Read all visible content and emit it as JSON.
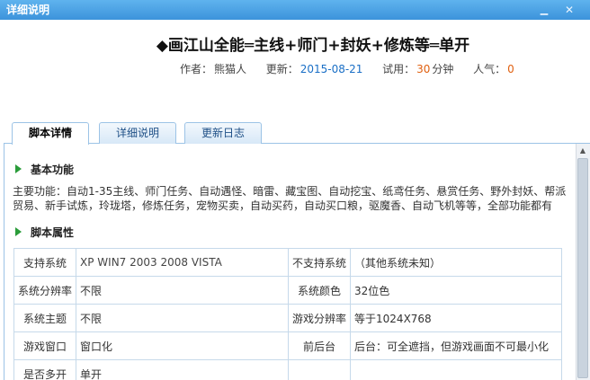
{
  "window": {
    "title": "详细说明",
    "minimize_icon": "minimize-icon",
    "close_icon": "close-icon"
  },
  "script": {
    "title": "◆画江山全能═主线+师门+封妖+修炼等═单开",
    "author_label": "作者：",
    "author": "熊猫人",
    "update_label": "更新：",
    "update_date": "2015-08-21",
    "trial_label": "试用：",
    "trial_value": "30",
    "trial_unit": "分钟",
    "popularity_label": "人气：",
    "popularity_value": "0"
  },
  "tabs": [
    {
      "label": "脚本详情",
      "active": true
    },
    {
      "label": "详细说明",
      "active": false
    },
    {
      "label": "更新日志",
      "active": false
    }
  ],
  "sections": {
    "basic_title": "基本功能",
    "basic_desc": "主要功能：自动1-35主线、师门任务、自动遇怪、暗雷、藏宝图、自动挖宝、纸鸢任务、悬赏任务、野外封妖、帮派贸易、新手试炼，玲珑塔，修炼任务，宠物买卖，自动买药，自动买口粮，驱魔香、自动飞机等等，全部功能都有",
    "attr_title": "脚本属性"
  },
  "attributes": [
    {
      "k1": "支持系统",
      "v1": "XP WIN7 2003 2008 VISTA",
      "k2": "不支持系统",
      "v2": "（其他系统未知）"
    },
    {
      "k1": "系统分辨率",
      "v1": "不限",
      "k2": "系统颜色",
      "v2": "32位色"
    },
    {
      "k1": "系统主题",
      "v1": "不限",
      "k2": "游戏分辨率",
      "v2": "等于1024X768"
    },
    {
      "k1": "游戏窗口",
      "v1": "窗口化",
      "k2": "前后台",
      "v2": "后台：可全遮挡，但游戏画面不可最小化"
    },
    {
      "k1": "是否多开",
      "v1": "单开",
      "k2": "",
      "v2": ""
    }
  ],
  "colors": {
    "titlebar": "#3c93db",
    "accent_green": "#2a9c3a",
    "date": "#1a6fc6",
    "number": "#e06010"
  }
}
